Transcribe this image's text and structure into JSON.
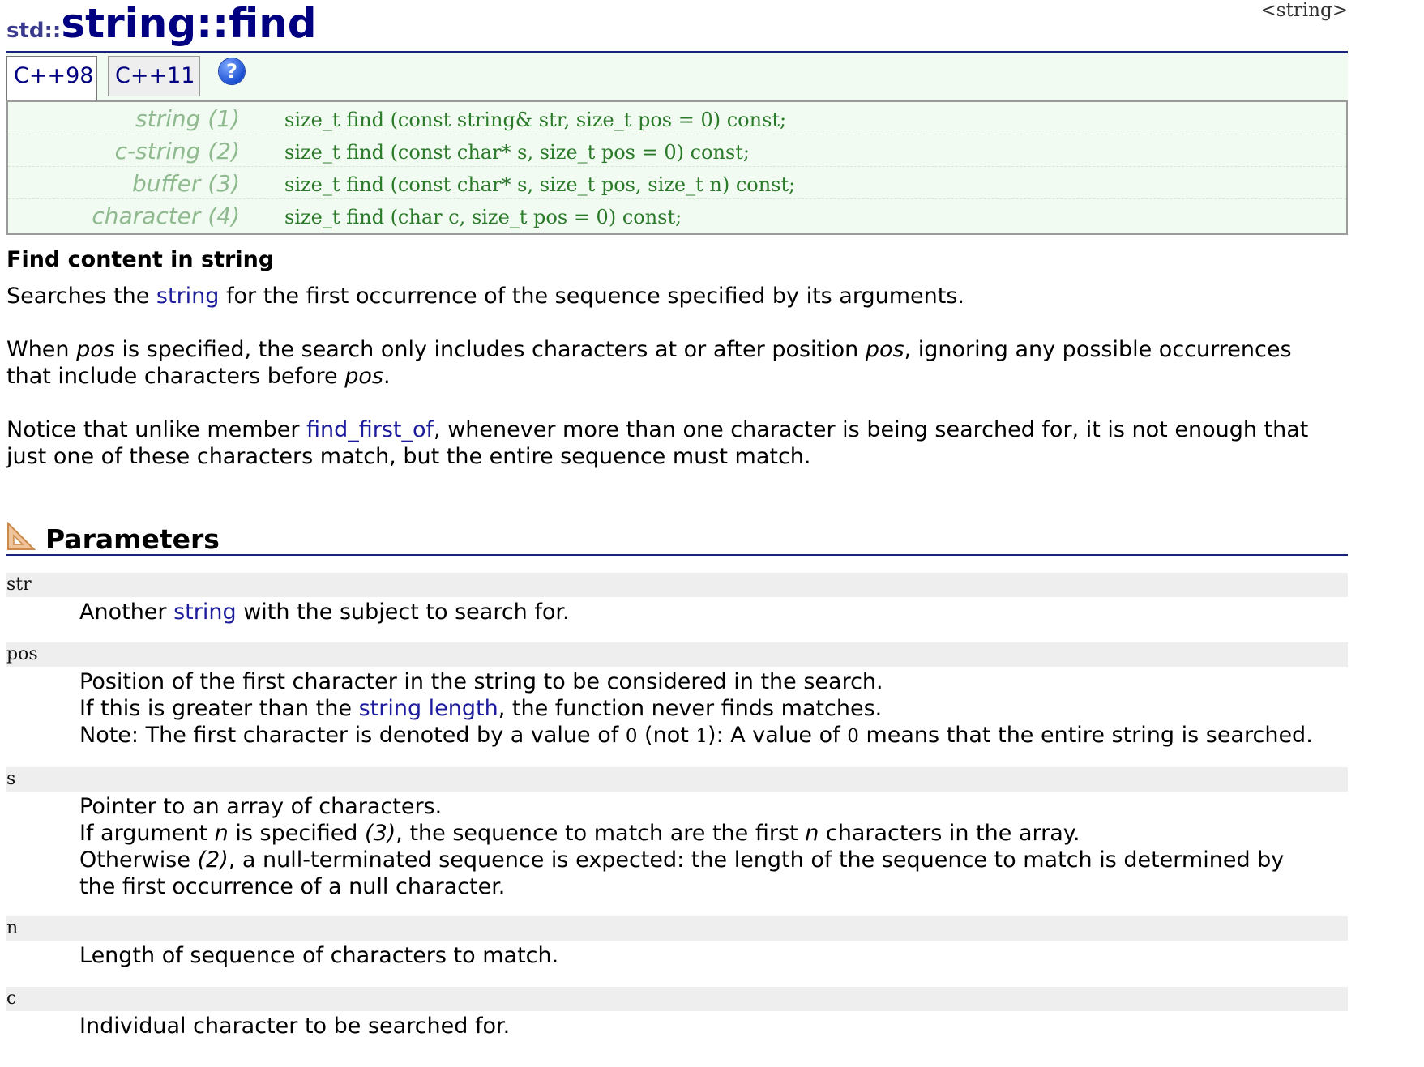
{
  "header": {
    "namespace": "std::",
    "title": "string::find",
    "header_tag": "<string>"
  },
  "tabs": [
    {
      "label": "C++98",
      "active": true
    },
    {
      "label": "C++11",
      "active": false
    }
  ],
  "help_icon": "?",
  "prototypes": [
    {
      "label": "string (1)",
      "code": "size_t find (const string& str, size_t pos = 0) const;"
    },
    {
      "label": "c-string (2)",
      "code": "size_t find (const char* s, size_t pos = 0) const;"
    },
    {
      "label": "buffer (3)",
      "code": "size_t find (const char* s, size_t pos, size_t n) const;"
    },
    {
      "label": "character (4)",
      "code": "size_t find (char c, size_t pos = 0) const;"
    }
  ],
  "description": {
    "heading": "Find content in string",
    "p1": {
      "a": "Searches the ",
      "link": "string",
      "b": " for the first occurrence of the sequence specified by its arguments."
    },
    "p2": {
      "a": "When ",
      "em1": "pos",
      "b": " is specified, the search only includes characters at or after position ",
      "em2": "pos",
      "c": ", ignoring any possible occurrences",
      "line2a": "that include characters before ",
      "em3": "pos",
      "line2b": "."
    },
    "p3": {
      "a": "Notice that unlike member ",
      "link": "find_first_of",
      "b": ", whenever more than one character is being searched for, it is not enough that",
      "line2": "just one of these characters match, but the entire sequence must match."
    }
  },
  "parameters": {
    "title": "Parameters",
    "str": {
      "name": "str",
      "a": "Another ",
      "link": "string",
      "b": " with the subject to search for."
    },
    "pos": {
      "name": "pos",
      "line1": "Position of the first character in the string to be considered in the search.",
      "line2a": "If this is greater than the ",
      "line2link": "string length",
      "line2b": ", the function never finds matches.",
      "line3a": "Note: The first character is denoted by a value of ",
      "zero1": "0",
      "line3b": " (not ",
      "one": "1",
      "line3c": "): A value of ",
      "zero2": "0",
      "line3d": " means that the entire string is searched."
    },
    "s": {
      "name": "s",
      "line1": "Pointer to an array of characters.",
      "line2a": "If argument ",
      "line2em": "n",
      "line2b": " is specified ",
      "line2ref": "(3)",
      "line2c": ", the sequence to match are the first ",
      "line2em2": "n",
      "line2d": " characters in the array.",
      "line3a": "Otherwise ",
      "line3ref": "(2)",
      "line3b": ", a null-terminated sequence is expected: the length of the sequence to match is determined by",
      "line4": "the first occurrence of a null character."
    },
    "n": {
      "name": "n",
      "desc": "Length of sequence of characters to match."
    },
    "c": {
      "name": "c",
      "desc": "Individual character to be searched for."
    }
  },
  "colors": {
    "title": "#000080",
    "link": "#1c1c9c",
    "proto_bg": "#f1fbf1",
    "proto_code": "#2a7a2a",
    "proto_label": "#8fba8f"
  }
}
